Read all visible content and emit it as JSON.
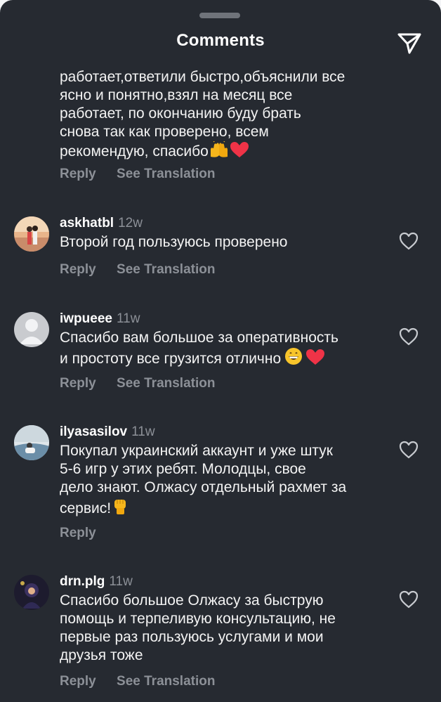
{
  "header": {
    "title": "Comments",
    "send_icon": "paper-plane-icon"
  },
  "partial_comment": {
    "text": "работает,ответили быстро,объяснили все\nясно и понятно,взял на месяц все\nработает, по окончанию буду брать\nснова так как проверено, всем\nрекомендую, спасибо",
    "emoji": [
      "raising-hands-icon",
      "red-heart-icon"
    ],
    "actions": {
      "reply": "Reply",
      "translation": "See Translation"
    }
  },
  "comments": [
    {
      "username": "askhatbl",
      "time": "12w",
      "text": "Второй год пользуюсь проверено",
      "reply": "Reply",
      "translation": "See Translation"
    },
    {
      "username": "iwpueee",
      "time": "11w",
      "text": "Спасибо вам большое за оперативность\nи простоту все грузится отлично",
      "emoji": [
        "grinning-face-icon",
        "red-heart-icon"
      ],
      "reply": "Reply",
      "translation": "See Translation"
    },
    {
      "username": "ilyasasilov",
      "time": "11w",
      "text": "Покупал украинский аккаунт и уже штук\n5-6 игр у этих ребят. Молодцы, свое\nдело знают. Олжасу отдельный рахмет за\nсервис!",
      "emoji": [
        "raised-fist-icon"
      ],
      "reply": "Reply"
    },
    {
      "username": "drn.plg",
      "time": "11w",
      "text": "Спасибо большое Олжасу за быструю\nпомощь и терпеливую консультацию, не\nпервые раз пользуюсь услугами и мои\nдрузья тоже",
      "reply": "Reply",
      "translation": "See Translation"
    }
  ],
  "colors": {
    "background": "#262a31",
    "muted_text": "#8c9097",
    "heart_red": "#ef3347"
  }
}
